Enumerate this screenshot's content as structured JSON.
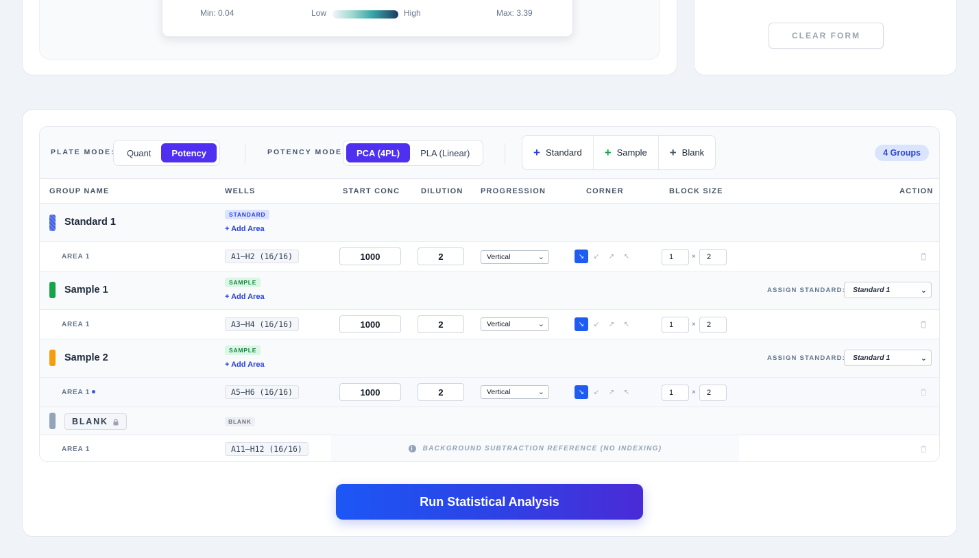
{
  "legend": {
    "min": "Min: 0.04",
    "low": "Low",
    "high": "High",
    "max": "Max: 3.39"
  },
  "clear_form": "CLEAR FORM",
  "toolbar": {
    "plate_mode_label": "PLATE MODE:",
    "plate_modes": [
      "Quant",
      "Potency"
    ],
    "plate_mode_active": "Potency",
    "potency_mode_label": "POTENCY MODE:",
    "potency_modes": [
      "PCA (4PL)",
      "PLA (Linear)"
    ],
    "potency_mode_active": "PCA (4PL)",
    "add_buttons": [
      {
        "label": "Standard",
        "color": "#2b3fd8"
      },
      {
        "label": "Sample",
        "color": "#16a34a"
      },
      {
        "label": "Blank",
        "color": "#475569"
      }
    ],
    "group_count": "4 Groups"
  },
  "columns": [
    "GROUP NAME",
    "WELLS",
    "START CONC",
    "DILUTION",
    "PROGRESSION",
    "CORNER",
    "BLOCK SIZE",
    "ACTION"
  ],
  "groups": [
    {
      "name": "Standard 1",
      "color": "#3b5bdb",
      "type": "STANDARD",
      "add_area": "+ Add Area",
      "area": {
        "label": "AREA 1",
        "wells": "A1–H2 (16/16)",
        "start_conc": "1000",
        "dilution": "2",
        "progression": "Vertical",
        "block_w": "1",
        "block_h": "2"
      }
    },
    {
      "name": "Sample 1",
      "color": "#16a34a",
      "type": "SAMPLE",
      "add_area": "+ Add Area",
      "assign_label": "ASSIGN STANDARD:",
      "assign_value": "Standard 1",
      "area": {
        "label": "AREA 1",
        "wells": "A3–H4 (16/16)",
        "start_conc": "1000",
        "dilution": "2",
        "progression": "Vertical",
        "block_w": "1",
        "block_h": "2"
      }
    },
    {
      "name": "Sample 2",
      "color": "#f59e0b",
      "type": "SAMPLE",
      "add_area": "+ Add Area",
      "assign_label": "ASSIGN STANDARD:",
      "assign_value": "Standard 1",
      "area": {
        "label": "AREA 1",
        "wells": "A5–H6 (16/16)",
        "start_conc": "1000",
        "dilution": "2",
        "progression": "Vertical",
        "block_w": "1",
        "block_h": "2"
      }
    },
    {
      "name": "BLANK",
      "color": "#94a3b8",
      "type": "BLANK",
      "area": {
        "label": "AREA 1",
        "wells": "A11–H12 (16/16)",
        "note": "BACKGROUND SUBTRACTION REFERENCE (NO INDEXING)"
      }
    }
  ],
  "corner_icons": [
    "↘",
    "↙",
    "↗",
    "↖"
  ],
  "run_button": "Run Statistical Analysis"
}
